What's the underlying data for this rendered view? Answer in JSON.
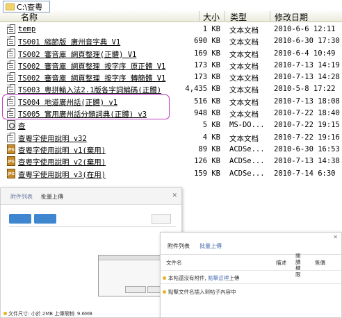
{
  "address": {
    "path": "C:\\查粵"
  },
  "columns": {
    "name": "名称",
    "size": "大小",
    "type": "类型",
    "modified": "修改日期"
  },
  "files": [
    {
      "icon": "doc",
      "name": "temp",
      "size": "1 KB",
      "type": "文本文档",
      "date": "2010-6-6 12:11"
    },
    {
      "icon": "doc",
      "name": "TS001 縮節版 廣州音字典 V1",
      "size": "690 KB",
      "type": "文本文档",
      "date": "2010-6-30 17:30"
    },
    {
      "icon": "doc",
      "name": "TS002 審音庫 網頁整理(正體) V1",
      "size": "169 KB",
      "type": "文本文档",
      "date": "2010-6-4 10:49"
    },
    {
      "icon": "doc",
      "name": "TS002 審音庫 網頁整理 按字序 原正體 V1",
      "size": "173 KB",
      "type": "文本文档",
      "date": "2010-7-13 14:19"
    },
    {
      "icon": "doc",
      "name": "TS002 審音庫 網頁整理 按字序 轉簡體 V1",
      "size": "173 KB",
      "type": "文本文档",
      "date": "2010-7-13 14:28"
    },
    {
      "icon": "doc",
      "name": "TS003 粵拼輸入法2.1版各字詞編碼(正體)",
      "size": "4,435 KB",
      "type": "文本文档",
      "date": "2010-5-8 17:22"
    },
    {
      "icon": "doc",
      "name": "TS004 地道廣州話(正體) v1",
      "size": "516 KB",
      "type": "文本文档",
      "date": "2010-7-13 18:08"
    },
    {
      "icon": "doc",
      "name": "TS005 實用廣州話分類詞典(正體) v3",
      "size": "948 KB",
      "type": "文本文档",
      "date": "2010-7-22 18:40"
    },
    {
      "icon": "exe",
      "name": "查",
      "size": "5 KB",
      "type": "MS-DO...",
      "date": "2010-7-22 19:15"
    },
    {
      "icon": "doc",
      "name": "查粵字使用說明 v32",
      "size": "4 KB",
      "type": "文本文档",
      "date": "2010-7-22 19:16"
    },
    {
      "icon": "jpg",
      "name": "查粵字使用說明 v1(棄用)",
      "size": "89 KB",
      "type": "ACDSe...",
      "date": "2010-6-30 16:53"
    },
    {
      "icon": "jpg",
      "name": "查粵字使用說明 v2(棄用)",
      "size": "126 KB",
      "type": "ACDSe...",
      "date": "2010-7-13 14:38"
    },
    {
      "icon": "jpg",
      "name": "查粵字使用說明 v3(在用)",
      "size": "159 KB",
      "type": "ACDSe...",
      "date": "2010-7-14 6:30"
    }
  ],
  "upload_dialog": {
    "tab_list": "附件列表",
    "tab_batch": "批量上傳",
    "footer": "文件尺寸: 小於 2MB  上傳限制: 9.6MB"
  },
  "attach_dialog": {
    "tab_list": "附件列表",
    "tab_upload": "批量上傳",
    "col_filename": "文件名",
    "col_desc": "描述",
    "col_perm": "閱讀權限",
    "col_price": "售價",
    "hint1_prefix": "本帖還沒有附件, ",
    "hint1_link": "點擊這裡",
    "hint1_suffix": "上傳",
    "hint2": "點擊文件名插入到帖子內容中"
  }
}
